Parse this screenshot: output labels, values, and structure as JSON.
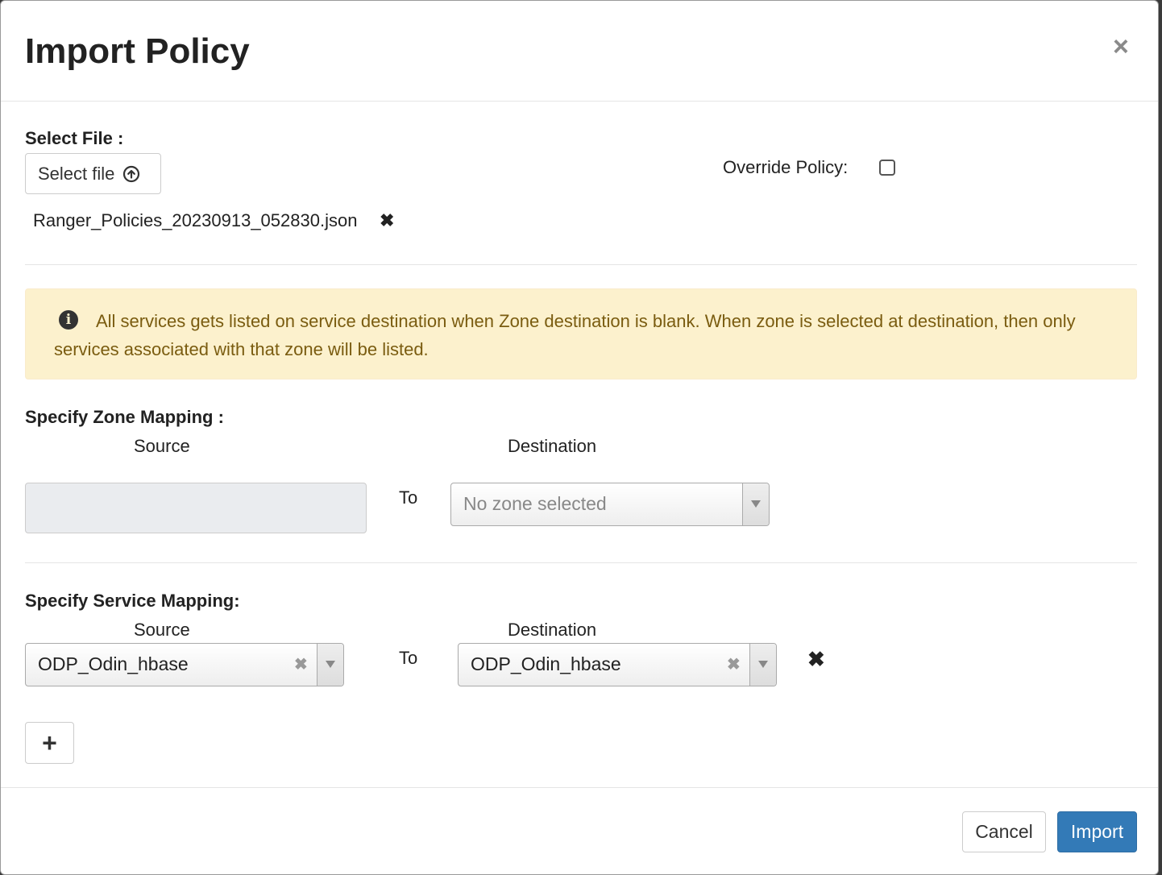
{
  "modal": {
    "title": "Import Policy",
    "close_symbol": "×"
  },
  "file_section": {
    "label": "Select File :",
    "select_button_label": "Select file",
    "select_button_icon": "upload-circle-icon",
    "selected_file_name": "Ranger_Policies_20230913_052830.json",
    "remove_icon": "✖"
  },
  "override": {
    "label": "Override Policy:",
    "checked": false
  },
  "alert": {
    "icon": "info-icon",
    "icon_glyph": "i",
    "text": "All services gets listed on service destination when Zone destination is blank. When zone is selected at destination, then only services associated with that zone will be listed."
  },
  "zone_mapping": {
    "label": "Specify Zone Mapping :",
    "source_header": "Source",
    "destination_header": "Destination",
    "to_label": "To",
    "source_value": "",
    "destination_placeholder": "No zone selected"
  },
  "service_mapping": {
    "label": "Specify Service Mapping:",
    "source_header": "Source",
    "destination_header": "Destination",
    "rows": [
      {
        "source": "ODP_Odin_hbase",
        "to_label": "To",
        "destination": "ODP_Odin_hbase",
        "clear_symbol": "✖",
        "remove_symbol": "✖"
      }
    ],
    "add_symbol": "+"
  },
  "footer": {
    "cancel_label": "Cancel",
    "import_label": "Import"
  },
  "colors": {
    "primary": "#337ab7",
    "alert_bg": "#fcf1cd",
    "alert_text": "#7a5c10"
  }
}
